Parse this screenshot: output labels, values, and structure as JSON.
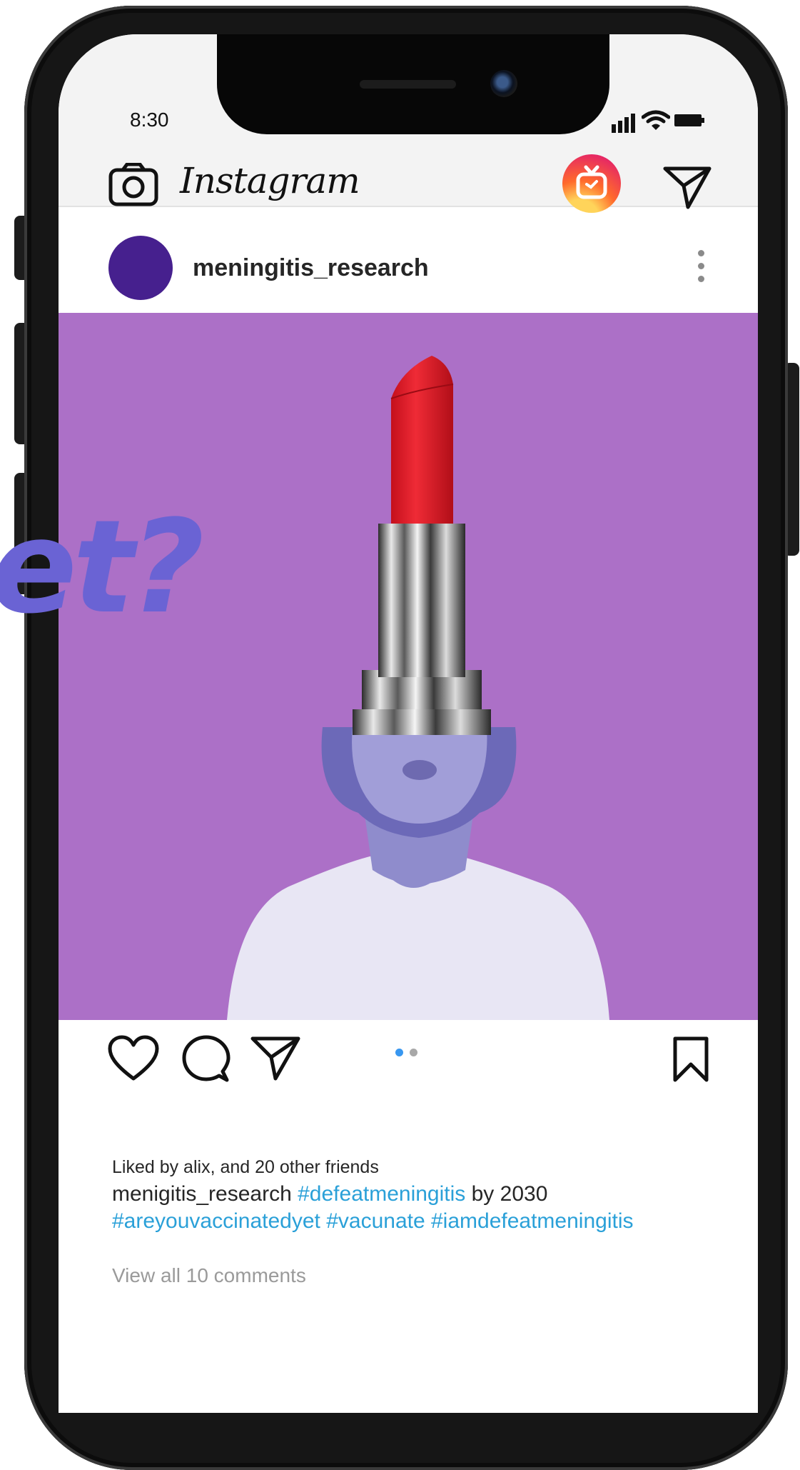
{
  "status_bar": {
    "time": "8:30"
  },
  "app": {
    "name": "Instagram"
  },
  "post": {
    "username": "meningitis_research",
    "overlay_text": "et?",
    "carousel": {
      "count": 2,
      "active_index": 0
    },
    "liked_by": "Liked by alix, and 20 other friends",
    "caption": {
      "author": "menigitis_research",
      "hashtag_1": "#defeatmeningitis",
      "text_1": "by 2030",
      "hashtag_2": "#areyouvaccinatedyet",
      "hashtag_3": "#vacunate",
      "hashtag_4": "#iamdefeatmeningitis"
    },
    "comments_link": "View all 10 comments"
  },
  "colors": {
    "post_background": "#ac70c7",
    "avatar": "#46208e",
    "hashtag": "#2aa0d8",
    "overlay_text": "#6a63d4"
  },
  "icons": [
    "camera-icon",
    "igtv-icon",
    "direct-message-icon",
    "more-options-icon",
    "heart-icon",
    "comment-icon",
    "share-icon",
    "bookmark-icon"
  ]
}
